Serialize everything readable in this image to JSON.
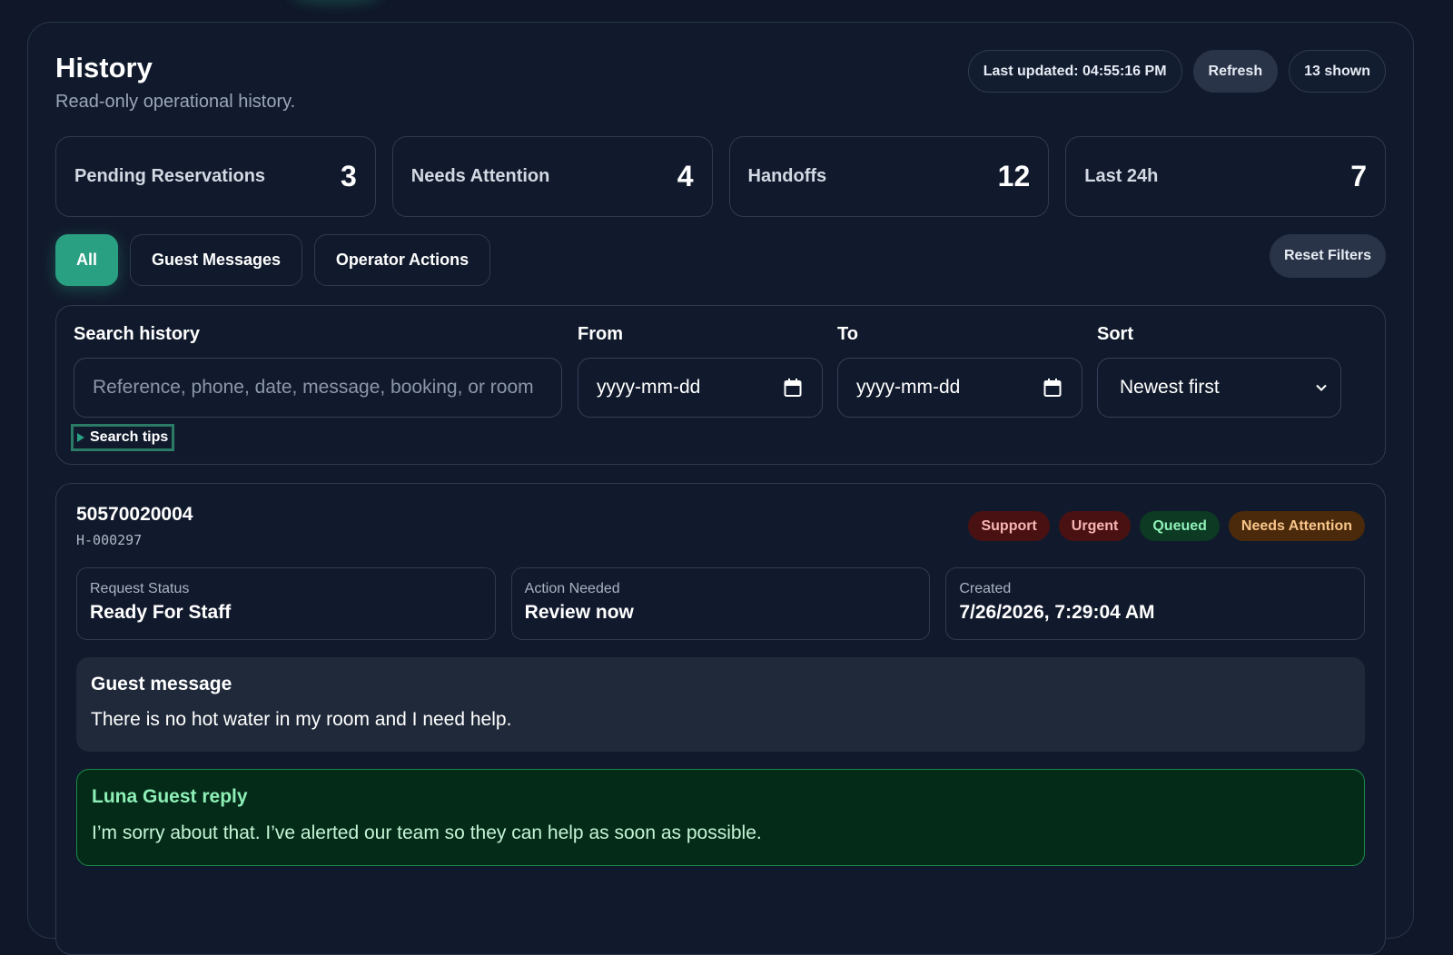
{
  "header": {
    "title": "History",
    "subtitle": "Read-only operational history.",
    "last_updated": "Last updated: 04:55:16 PM",
    "refresh_label": "Refresh",
    "shown_count": "13 shown"
  },
  "stats": [
    {
      "label": "Pending Reservations",
      "value": "3"
    },
    {
      "label": "Needs Attention",
      "value": "4"
    },
    {
      "label": "Handoffs",
      "value": "12"
    },
    {
      "label": "Last 24h",
      "value": "7"
    }
  ],
  "filters": {
    "tabs": [
      {
        "label": "All",
        "active": true
      },
      {
        "label": "Guest Messages",
        "active": false
      },
      {
        "label": "Operator Actions",
        "active": false
      }
    ],
    "reset_label": "Reset Filters"
  },
  "search": {
    "search_label": "Search history",
    "search_placeholder": "Reference, phone, date, message, booking, or room",
    "from_label": "From",
    "from_value": "yyyy-mm-dd",
    "to_label": "To",
    "to_value": "yyyy-mm-dd",
    "sort_label": "Sort",
    "sort_value": "Newest first",
    "tips_label": "Search tips"
  },
  "entry": {
    "reference": "50570020004",
    "handoff_id": "H-000297",
    "badges": [
      "Support",
      "Urgent",
      "Queued",
      "Needs Attention"
    ],
    "info": [
      {
        "label": "Request Status",
        "value": "Ready For Staff"
      },
      {
        "label": "Action Needed",
        "value": "Review now"
      },
      {
        "label": "Created",
        "value": "7/26/2026, 7:29:04 AM"
      }
    ],
    "guest_message_title": "Guest message",
    "guest_message_text": "There is no hot water in my room and I need help.",
    "reply_title": "Luna Guest reply",
    "reply_text": "I’m sorry about that. I’ve alerted our team so they can help as soon as possible."
  },
  "colors": {
    "accent": "#2aa082",
    "background": "#0f1729",
    "panel": "#111a2c",
    "support_badge": "#4a1113",
    "queued_badge": "#0c3a23",
    "attention_badge": "#4b2a0c",
    "reply_bg": "#032b18"
  },
  "icons": [
    "calendar-icon",
    "chevron-down-icon",
    "triangle-right-icon"
  ]
}
